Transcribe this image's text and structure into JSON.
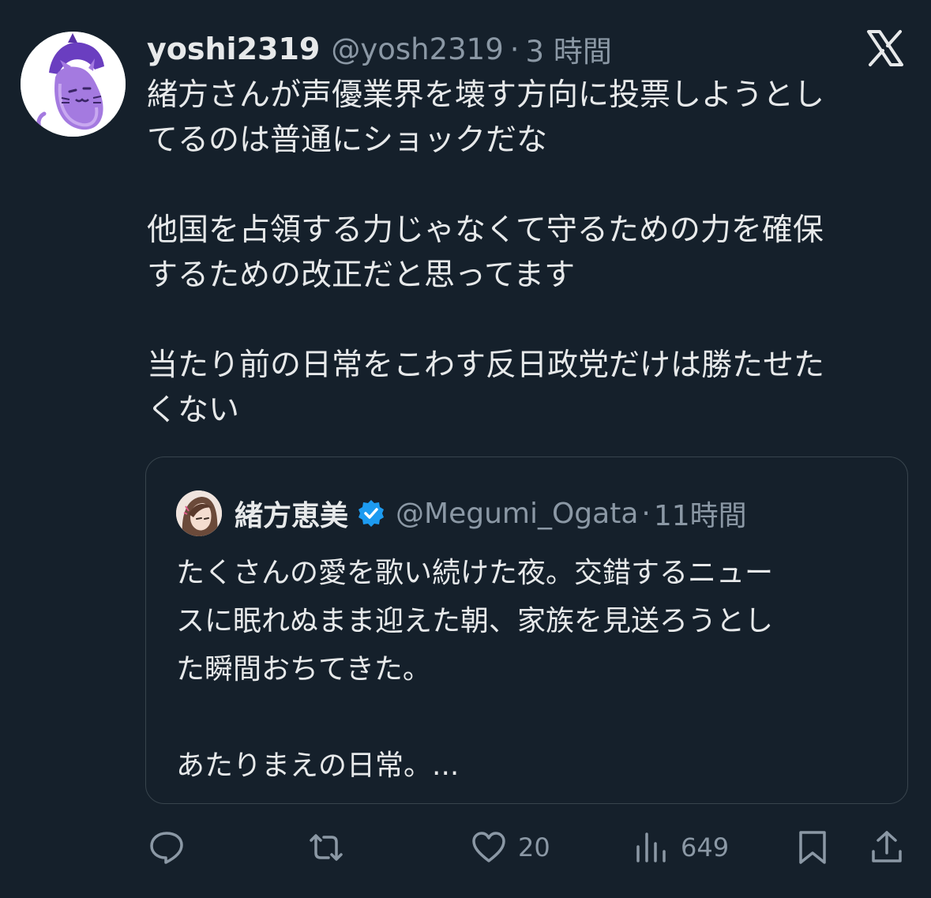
{
  "tweet": {
    "display_name": "yoshi2319",
    "handle": "@yosh2319",
    "separator": "·",
    "time": "3 時間",
    "avatar_icon": "eggplant-cat-avatar",
    "text": "緒方さんが声優業界を壊す方向に投票しようとし\nてるのは普通にショックだな\n\n他国を占領する力じゃなくて守るための力を確保\nするための改正だと思ってます\n\n当たり前の日常をこわす反日政党だけは勝たせた\nくない"
  },
  "platform_logo": "x-logo",
  "quoted_tweet": {
    "display_name": "緒方恵美",
    "verified_icon": "verified-badge-icon",
    "handle": "@Megumi_Ogata",
    "separator": "·",
    "time": "11時間",
    "text": "たくさんの愛を歌い続けた夜。交錯するニュー\nスに眠れぬまま迎えた朝、家族を見送ろうとし\nた瞬間おちてきた。\n\nあたりまえの日常。..."
  },
  "actions": {
    "reply_icon": "reply-icon",
    "retweet_icon": "retweet-icon",
    "like_icon": "heart-icon",
    "like_count": "20",
    "views_icon": "views-icon",
    "view_count": "649",
    "bookmark_icon": "bookmark-icon",
    "share_icon": "share-icon"
  },
  "colors": {
    "background": "#15202b",
    "text": "#e7e9ea",
    "secondary_text": "#8b98a5",
    "border": "#38444d",
    "verified": "#1d9bf0",
    "avatar_purple": "#8e5fd6"
  }
}
